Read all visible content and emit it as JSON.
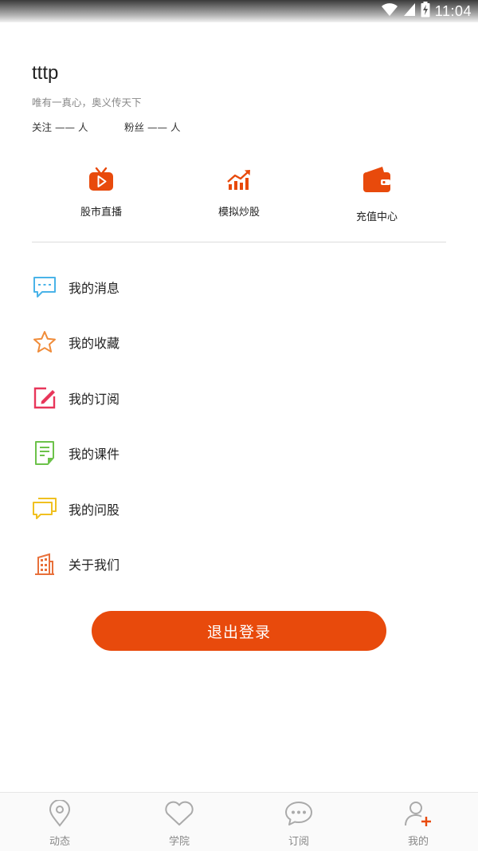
{
  "status_bar": {
    "time": "11:04"
  },
  "profile": {
    "username": "tttp",
    "motto": "唯有一真心，奥义传天下",
    "following": "关注 —— 人",
    "followers": "粉丝 —— 人"
  },
  "quick_actions": [
    {
      "label": "股市直播",
      "icon": "tv-play-icon"
    },
    {
      "label": "模拟炒股",
      "icon": "stock-chart-icon"
    },
    {
      "label": "充值中心",
      "icon": "wallet-icon"
    }
  ],
  "menu": [
    {
      "label": "我的消息",
      "icon": "message-icon",
      "color": "#4ab3e8"
    },
    {
      "label": "我的收藏",
      "icon": "star-icon",
      "color": "#f08c3a"
    },
    {
      "label": "我的订阅",
      "icon": "edit-icon",
      "color": "#e8365a"
    },
    {
      "label": "我的课件",
      "icon": "courseware-icon",
      "color": "#6cc24a"
    },
    {
      "label": "我的问股",
      "icon": "chat-bubbles-icon",
      "color": "#f0c020"
    },
    {
      "label": "关于我们",
      "icon": "building-icon",
      "color": "#e8703a"
    }
  ],
  "logout_label": "退出登录",
  "bottom_nav": [
    {
      "label": "动态",
      "icon": "location-pin-icon"
    },
    {
      "label": "学院",
      "icon": "heart-icon"
    },
    {
      "label": "订阅",
      "icon": "chat-dots-icon"
    },
    {
      "label": "我的",
      "icon": "user-add-icon"
    }
  ],
  "colors": {
    "accent": "#e84a0c",
    "text": "#222222",
    "muted": "#888888"
  }
}
